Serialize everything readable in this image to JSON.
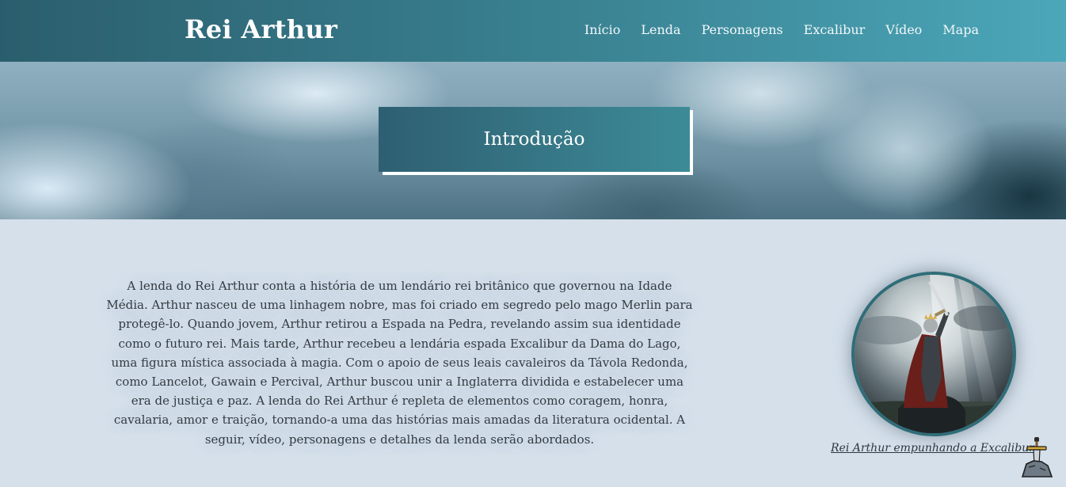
{
  "header": {
    "brand": "Rei Arthur",
    "nav": [
      "Início",
      "Lenda",
      "Personagens",
      "Excalibur",
      "Vídeo",
      "Mapa"
    ]
  },
  "hero": {
    "title": "Introdução"
  },
  "intro": {
    "text": "A lenda do Rei Arthur conta a história de um lendário rei britânico que governou na Idade Média. Arthur nasceu de uma linhagem nobre, mas foi criado em segredo pelo mago Merlin para protegê-lo. Quando jovem, Arthur retirou a Espada na Pedra, revelando assim sua identidade como o futuro rei. Mais tarde, Arthur recebeu a lendária espada Excalibur da Dama do Lago, uma figura mística associada à magia. Com o apoio de seus leais cavaleiros da Távola Redonda, como Lancelot, Gawain e Percival, Arthur buscou unir a Inglaterra dividida e estabelecer uma era de justiça e paz. A lenda do Rei Arthur é repleta de elementos como coragem, honra, cavalaria, amor e traição, tornando-a uma das histórias mais amadas da literatura ocidental. A seguir, vídeo, personagens e detalhes da lenda serão abordados.",
    "image_caption": "Rei Arthur empunhando a Excalibur"
  },
  "icons": {
    "sword_widget": "sword-in-stone-icon"
  },
  "colors": {
    "nav_start": "#2b5e6d",
    "nav_end": "#4ba7b9",
    "page_bg": "#d5e0eb",
    "portrait_border": "#2f6d78"
  }
}
